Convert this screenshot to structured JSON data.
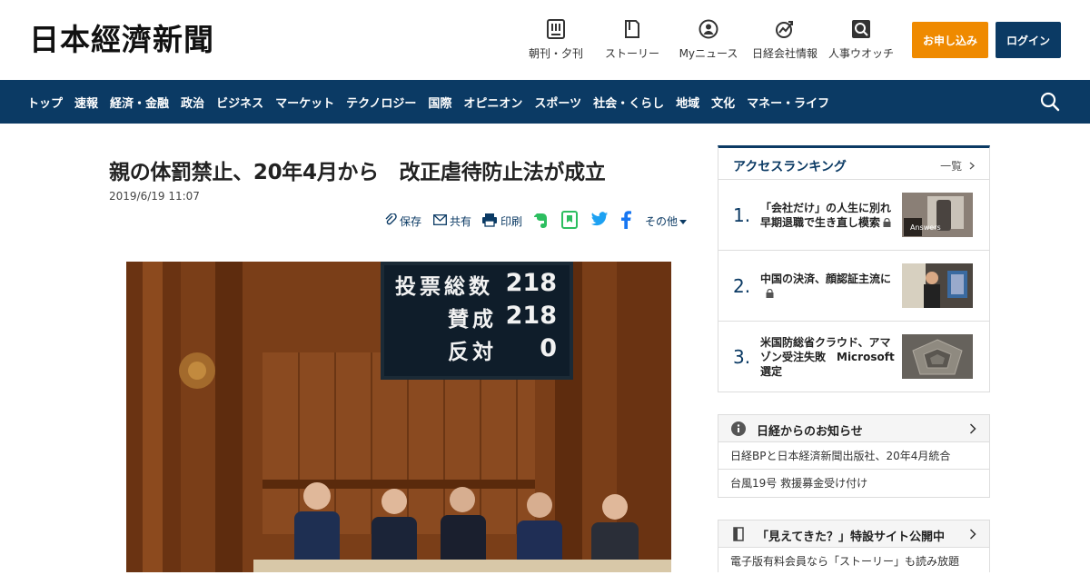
{
  "header": {
    "logo": "日本經濟新聞",
    "nav": [
      {
        "label": "朝刊・夕刊",
        "icon": "newspaper-icon"
      },
      {
        "label": "ストーリー",
        "icon": "story-icon"
      },
      {
        "label": "Myニュース",
        "icon": "user-icon"
      },
      {
        "label": "日経会社情報",
        "icon": "company-info-icon"
      },
      {
        "label": "人事ウオッチ",
        "icon": "personnel-search-icon"
      }
    ],
    "subscribe_label": "お申し込み",
    "login_label": "ログイン"
  },
  "navbar": {
    "items": [
      "トップ",
      "速報",
      "経済・金融",
      "政治",
      "ビジネス",
      "マーケット",
      "テクノロジー",
      "国際",
      "オピニオン",
      "スポーツ",
      "社会・くらし",
      "地域",
      "文化",
      "マネー・ライフ"
    ]
  },
  "article": {
    "title": "親の体罰禁止、20年4月から　改正虐待防止法が成立",
    "date": "2019/6/19 11:07",
    "share": {
      "save": "保存",
      "share": "共有",
      "print": "印刷",
      "other": "その他"
    },
    "photo_board": {
      "row1_label": "投票総数",
      "row1_value": "218",
      "row2_label": "賛成",
      "row2_value": "218",
      "row3_label": "反対",
      "row3_value": "0"
    }
  },
  "ranking": {
    "title": "アクセスランキング",
    "more": "一覧",
    "items": [
      {
        "rank": "1.",
        "text": "「会社だけ」の人生に別れ　早期退職で生き直し模索",
        "locked": true
      },
      {
        "rank": "2.",
        "text": "中国の決済、顔認証主流に",
        "locked": true
      },
      {
        "rank": "3.",
        "text": "米国防総省クラウド、アマゾン受注失敗　Microsoft選定",
        "locked": false
      }
    ],
    "thumb1_caption": "Answers"
  },
  "notices": {
    "title": "日経からのお知らせ",
    "items": [
      "日経BPと日本経済新聞出版社、20年4月統合",
      "台風19号 救援募金受け付け"
    ]
  },
  "special": {
    "title": "「見えてきた？」特設サイト公開中",
    "text": "電子版有料会員なら「ストーリー」も読み放題"
  },
  "colors": {
    "navy": "#0b3a64",
    "orange": "#ef8a00",
    "evernote": "#2dbe60",
    "twitter": "#1da1f2",
    "facebook": "#1877f2"
  }
}
